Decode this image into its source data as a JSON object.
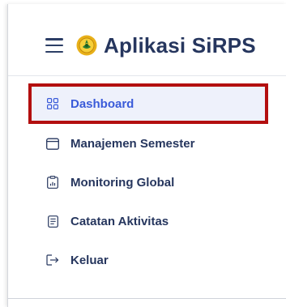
{
  "app": {
    "title": "Aplikasi SiRPS"
  },
  "menu": {
    "items": [
      {
        "label": "Dashboard",
        "icon": "dashboard-grid-icon",
        "active": true
      },
      {
        "label": "Manajemen Semester",
        "icon": "calendar-icon",
        "active": false
      },
      {
        "label": "Monitoring Global",
        "icon": "clipboard-chart-icon",
        "active": false
      },
      {
        "label": "Catatan Aktivitas",
        "icon": "notes-icon",
        "active": false
      },
      {
        "label": "Keluar",
        "icon": "logout-icon",
        "active": false
      }
    ]
  },
  "colors": {
    "text": "#26365e",
    "active_text": "#3a5bd9",
    "active_bg": "#eef1fb",
    "highlight_border": "#b30f0f",
    "logo_gold": "#e8b019",
    "logo_green": "#2e7d32"
  }
}
